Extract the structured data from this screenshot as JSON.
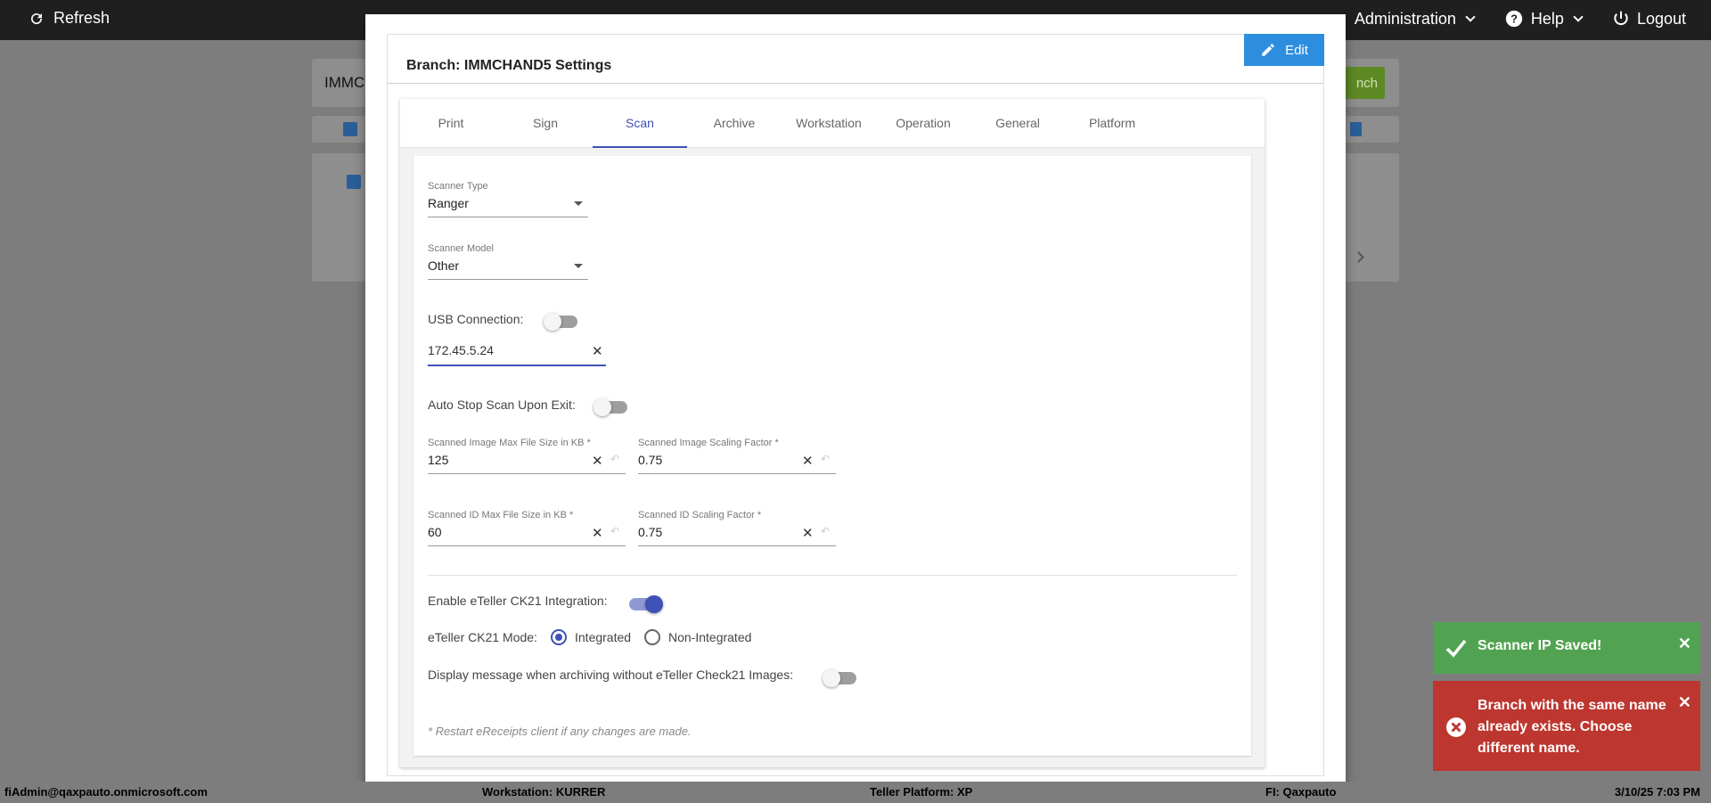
{
  "topbar": {
    "refresh_label": "Refresh",
    "administration_label": "Administration",
    "help_label": "Help",
    "logout_label": "Logout"
  },
  "background": {
    "search_value": "IMMCI",
    "add_branch_label": "nch"
  },
  "modal": {
    "title": "Branch: IMMCHAND5 Settings",
    "edit_label": "Edit",
    "tabs": [
      {
        "label": "Print"
      },
      {
        "label": "Sign"
      },
      {
        "label": "Scan"
      },
      {
        "label": "Archive"
      },
      {
        "label": "Workstation"
      },
      {
        "label": "Operation"
      },
      {
        "label": "General"
      },
      {
        "label": "Platform"
      }
    ],
    "active_tab": "Scan",
    "scan": {
      "scanner_type_label": "Scanner Type",
      "scanner_type_value": "Ranger",
      "scanner_model_label": "Scanner Model",
      "scanner_model_value": "Other",
      "usb_connection_label": "USB Connection:",
      "usb_connection_on": false,
      "ip_value": "172.45.5.24",
      "auto_stop_label": "Auto Stop Scan Upon Exit:",
      "auto_stop_on": false,
      "img_max_size_label": "Scanned Image Max File Size in KB *",
      "img_max_size_value": "125",
      "img_scaling_label": "Scanned Image Scaling Factor *",
      "img_scaling_value": "0.75",
      "id_max_size_label": "Scanned ID Max File Size in KB *",
      "id_max_size_value": "60",
      "id_scaling_label": "Scanned ID Scaling Factor *",
      "id_scaling_value": "0.75",
      "eteller_label": "Enable eTeller CK21 Integration:",
      "eteller_on": true,
      "mode_label": "eTeller CK21 Mode:",
      "mode_integrated": "Integrated",
      "mode_non_integrated": "Non-Integrated",
      "mode_selected": "Integrated",
      "display_msg_label": "Display message when archiving without eTeller Check21 Images:",
      "display_msg_on": false,
      "note": "* Restart eReceipts client if any changes are made."
    }
  },
  "toasts": {
    "success": "Scanner IP Saved!",
    "error": "Branch with the same name already exists. Choose different name."
  },
  "statusbar": {
    "user": "fiAdmin@qaxpauto.onmicrosoft.com",
    "workstation": "Workstation: KURRER",
    "platform": "Teller Platform: XP",
    "fi": "FI: Qaxpauto",
    "datetime": "3/10/25 7:03 PM"
  },
  "colors": {
    "accent": "#3f51b5",
    "edit_button": "#2d8ee0",
    "success": "#51a351",
    "error": "#bd362f"
  }
}
